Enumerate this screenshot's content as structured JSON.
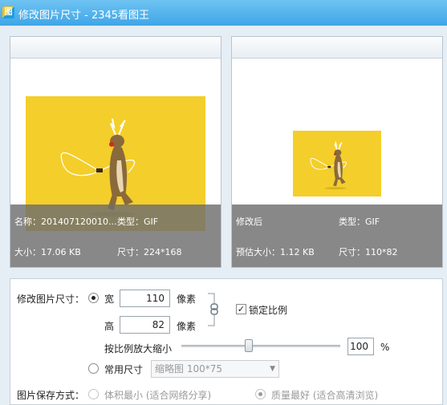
{
  "window": {
    "title": "修改图片尺寸 - 2345看图王",
    "app_icon_char": "图"
  },
  "original_panel": {
    "name_label": "名称：201407120010...",
    "type_label": "类型：GIF",
    "size_label": "大小：17.06 KB",
    "dims_label": "尺寸：224*168"
  },
  "modified_panel": {
    "title_label": "修改后",
    "type_label": "类型：GIF",
    "est_size_label": "预估大小：1.12 KB",
    "dims_label": "尺寸：110*82"
  },
  "resize": {
    "section_label": "修改图片尺寸：",
    "width_label": "宽",
    "width_value": "110",
    "width_unit": "像素",
    "height_label": "高",
    "height_value": "82",
    "height_unit": "像素",
    "lock_label": "锁定比例",
    "lock_checked": true,
    "scale_label": "按比例放大缩小",
    "scale_value": "100",
    "scale_unit": "%",
    "common_size_label": "常用尺寸",
    "common_size_option": "缩略图 100*75"
  },
  "save_mode": {
    "label": "图片保存方式：",
    "option_small": "体积最小 (适合网络分享)",
    "option_quality": "质量最好 (适合高清浏览)"
  },
  "colors": {
    "titlebar": "#4fb0ee",
    "preview_bg": "#f4ce2a",
    "overlay": "#6e6e6e"
  }
}
